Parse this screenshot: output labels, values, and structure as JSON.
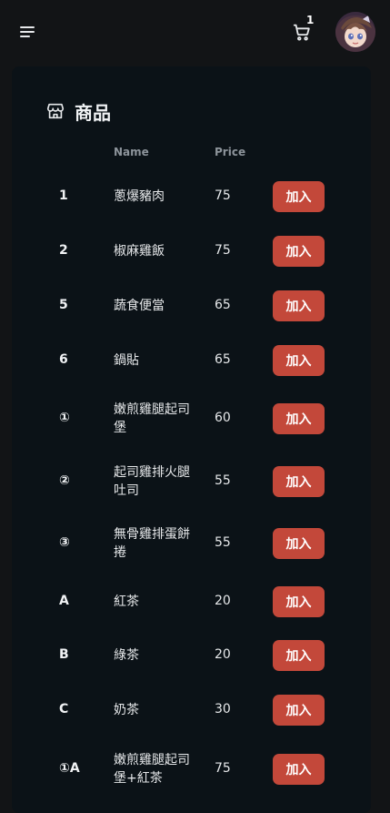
{
  "header": {
    "cart_count": "1"
  },
  "section": {
    "title": "商品",
    "columns": {
      "name": "Name",
      "price": "Price"
    }
  },
  "products": [
    {
      "id": "1",
      "name": "蔥爆豬肉",
      "price": "75",
      "button": "加入"
    },
    {
      "id": "2",
      "name": "椒麻雞飯",
      "price": "75",
      "button": "加入"
    },
    {
      "id": "5",
      "name": "蔬食便當",
      "price": "65",
      "button": "加入"
    },
    {
      "id": "6",
      "name": "鍋貼",
      "price": "65",
      "button": "加入"
    },
    {
      "id": "①",
      "name": "嫩煎雞腿起司堡",
      "price": "60",
      "button": "加入"
    },
    {
      "id": "②",
      "name": "起司雞排火腿吐司",
      "price": "55",
      "button": "加入"
    },
    {
      "id": "③",
      "name": "無骨雞排蛋餅捲",
      "price": "55",
      "button": "加入"
    },
    {
      "id": "A",
      "name": "紅茶",
      "price": "20",
      "button": "加入"
    },
    {
      "id": "B",
      "name": "綠茶",
      "price": "20",
      "button": "加入"
    },
    {
      "id": "C",
      "name": "奶茶",
      "price": "30",
      "button": "加入"
    },
    {
      "id": "①A",
      "name": "嫩煎雞腿起司堡+紅茶",
      "price": "75",
      "button": "加入"
    }
  ],
  "colors": {
    "accent": "#c3483a",
    "panel": "#0b1217",
    "background": "#121416"
  },
  "icons": {
    "menu": "hamburger-menu-icon",
    "cart": "cart-icon",
    "section": "store-icon"
  }
}
